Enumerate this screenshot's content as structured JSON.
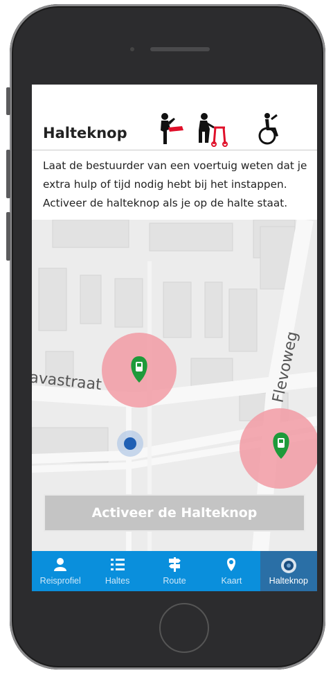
{
  "header": {
    "title": "Halteknop",
    "icons": [
      "kicking-person-icon",
      "walker-person-icon",
      "wheelchair-icon"
    ]
  },
  "description": "Laat de bestuurder van een voertuig weten dat je extra hulp of tijd nodig hebt bij het instappen. Activeer de halteknop als je op de halte staat.",
  "map": {
    "street_labels": [
      "avastraat",
      "Flevoweg"
    ],
    "stop_markers": [
      "tram-stop-marker",
      "tram-stop-marker"
    ],
    "user_location": "current-location-dot"
  },
  "activate_button": {
    "label": "Activeer de Halteknop",
    "enabled": false
  },
  "tabbar": {
    "items": [
      {
        "label": "Reisprofiel",
        "icon": "person-icon"
      },
      {
        "label": "Haltes",
        "icon": "list-icon"
      },
      {
        "label": "Route",
        "icon": "signpost-icon"
      },
      {
        "label": "Kaart",
        "icon": "map-pin-icon"
      },
      {
        "label": "Halteknop",
        "icon": "stop-button-icon"
      }
    ],
    "active": "Halteknop"
  },
  "colors": {
    "tabbar": "#0a8fdc",
    "tab_active": "#2a6fa6",
    "stop_zone": "#f2a0a8",
    "stop_marker": "#1e9a3a",
    "location_dot": "#1f5fb4",
    "button_disabled": "#c4c4c4"
  }
}
